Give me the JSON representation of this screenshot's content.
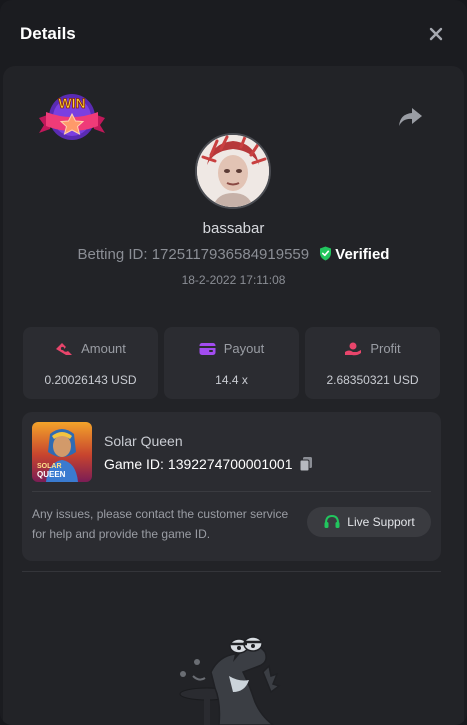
{
  "header": {
    "title": "Details"
  },
  "badge": {
    "text": "WIN"
  },
  "user": {
    "username": "bassabar"
  },
  "bet": {
    "betting_id_label": "Betting ID:",
    "betting_id": "1725117936584919559",
    "verified_label": "Verified",
    "datetime": "18-2-2022 17:11:08"
  },
  "stats": [
    {
      "label": "Amount",
      "value": "0.20026143 USD",
      "icon": "money-icon",
      "color": "#e8456b"
    },
    {
      "label": "Payout",
      "value": "14.4 x",
      "icon": "wallet-icon",
      "color": "#a24cf0"
    },
    {
      "label": "Profit",
      "value": "2.68350321 USD",
      "icon": "coins-hand-icon",
      "color": "#e8456b"
    }
  ],
  "game": {
    "name": "Solar Queen",
    "id_label": "Game ID:",
    "id": "1392274700001001",
    "thumb_text_1": "SOLAR",
    "thumb_text_2": "QUEEN",
    "help_text": "Any issues, please contact the customer service for help and provide the game ID.",
    "support_label": "Live Support"
  },
  "colors": {
    "verified": "#22c55e",
    "support_icon": "#22c55e",
    "accent_pink": "#e8456b",
    "accent_purple": "#a24cf0"
  }
}
